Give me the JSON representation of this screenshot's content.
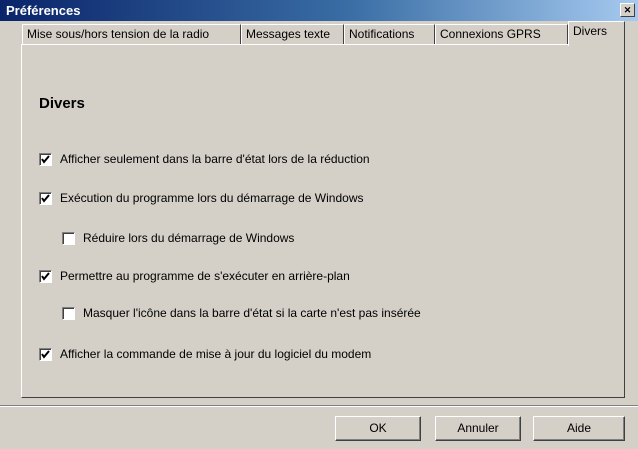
{
  "window": {
    "title": "Préférences",
    "close_glyph": "✕"
  },
  "tabs": [
    {
      "label": "Mise sous/hors tension de la radio",
      "active": false
    },
    {
      "label": "Messages texte",
      "active": false
    },
    {
      "label": "Notifications",
      "active": false
    },
    {
      "label": "Connexions GPRS",
      "active": false
    },
    {
      "label": "Divers",
      "active": true
    }
  ],
  "panel": {
    "heading": "Divers",
    "options": [
      {
        "label": "Afficher seulement dans la barre d'état lors de la réduction",
        "checked": true
      },
      {
        "label": "Exécution du programme lors du démarrage de Windows",
        "checked": true
      },
      {
        "label": "Réduire lors du démarrage de Windows",
        "checked": false
      },
      {
        "label": "Permettre au programme de s'exécuter en arrière-plan",
        "checked": true
      },
      {
        "label": "Masquer l'icône dans la barre d'état si la carte n'est pas insérée",
        "checked": false
      },
      {
        "label": "Afficher la commande de mise à jour du logiciel du modem",
        "checked": true
      }
    ]
  },
  "buttons": {
    "ok": "OK",
    "cancel": "Annuler",
    "help": "Aide"
  },
  "colors": {
    "titlebar_start": "#0a246a",
    "titlebar_end": "#a6caf0",
    "face": "#d4d0c8"
  }
}
